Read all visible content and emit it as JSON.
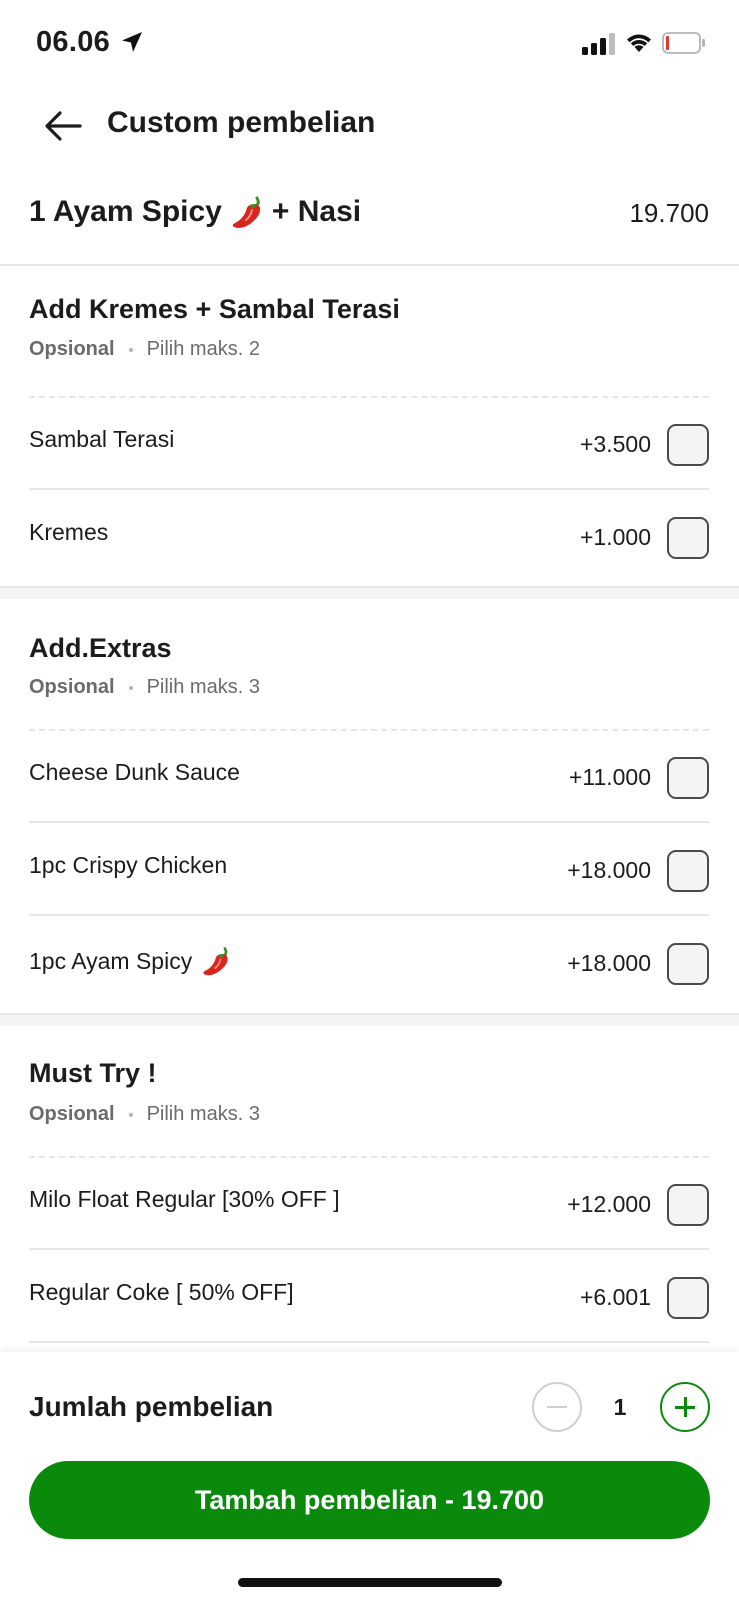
{
  "status_bar": {
    "time": "06.06"
  },
  "header": {
    "title": "Custom pembelian"
  },
  "product": {
    "name_part1": "1 Ayam Spicy",
    "name_part2": "+ Nasi",
    "price": "19.700"
  },
  "sections": [
    {
      "title": "Add Kremes + Sambal Terasi",
      "optional": "Opsional",
      "max": "Pilih maks. 2",
      "items": [
        {
          "label": "Sambal Terasi",
          "price": "+3.500"
        },
        {
          "label": "Kremes",
          "price": "+1.000"
        }
      ]
    },
    {
      "title": "Add.Extras",
      "optional": "Opsional",
      "max": "Pilih maks. 3",
      "items": [
        {
          "label": "Cheese Dunk Sauce",
          "price": "+11.000"
        },
        {
          "label": "1pc Crispy Chicken",
          "price": "+18.000"
        },
        {
          "label": "1pc Ayam Spicy",
          "price": "+18.000"
        }
      ]
    },
    {
      "title": "Must Try !",
      "optional": "Opsional",
      "max": "Pilih maks. 3",
      "items": [
        {
          "label": "Milo Float Regular [30% OFF ]",
          "price": "+12.000"
        },
        {
          "label": "Regular Coke [ 50% OFF]",
          "price": "+6.001"
        }
      ]
    }
  ],
  "footer": {
    "quantity_label": "Jumlah pembelian",
    "quantity": "1",
    "add_button": "Tambah pembelian - 19.700"
  },
  "colors": {
    "primary_green": "#0a8a0a",
    "divider": "#e6e6e6"
  },
  "icons": [
    "location-arrow-icon",
    "signal-icon",
    "wifi-icon",
    "battery-icon",
    "back-arrow-icon",
    "chili-pepper-icon",
    "minus-icon",
    "plus-icon"
  ]
}
